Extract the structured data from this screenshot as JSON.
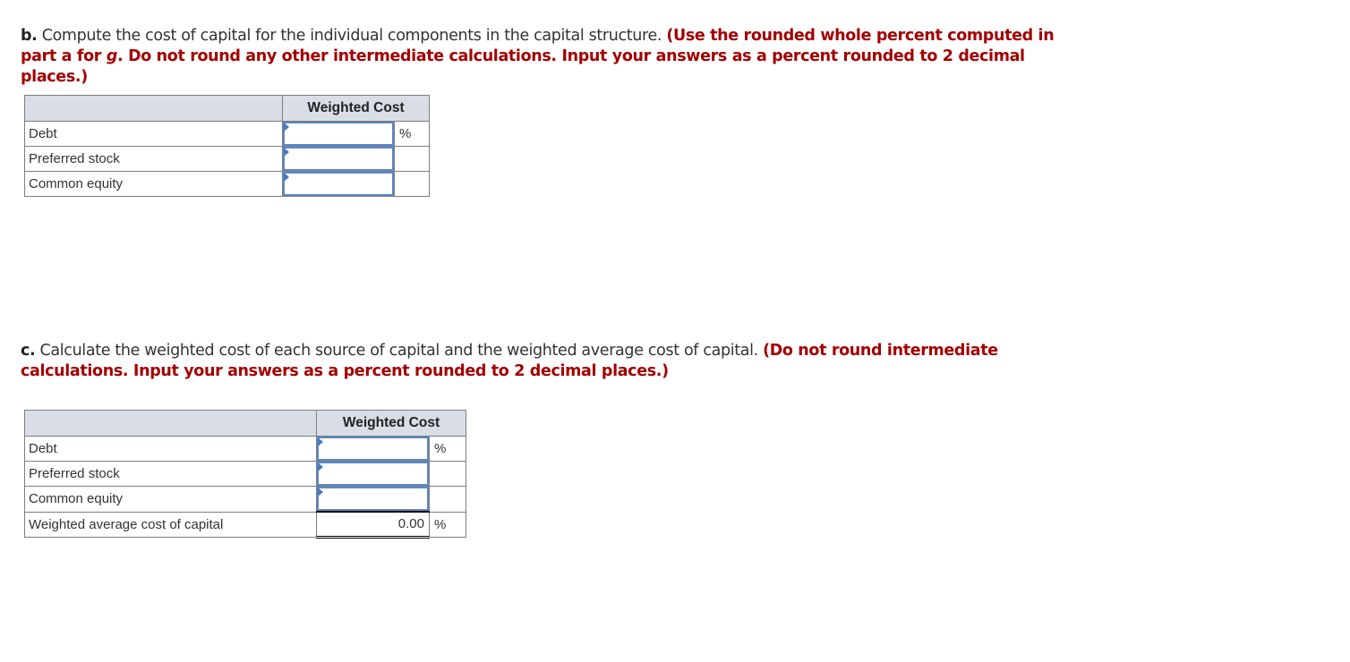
{
  "part_b": {
    "label": "b.",
    "text": " Compute the cost of capital for the individual components in the capital structure. ",
    "instruction_1": "(Use the rounded whole percent computed in part a for ",
    "instruction_var": "g",
    "instruction_2": ". Do not round any other intermediate calculations. Input your answers as a percent rounded to 2 decimal places.)",
    "table": {
      "header_blank": "",
      "header": "Weighted Cost",
      "rows": [
        {
          "label": "Debt",
          "value": "",
          "unit": "%"
        },
        {
          "label": "Preferred stock",
          "value": "",
          "unit": ""
        },
        {
          "label": "Common equity",
          "value": "",
          "unit": ""
        }
      ]
    }
  },
  "part_c": {
    "label": "c.",
    "text": " Calculate the weighted cost of each source of capital and the weighted average cost of capital. ",
    "instruction": "(Do not round intermediate calculations. Input your answers as a percent rounded to 2 decimal places.)",
    "table": {
      "header_blank": "",
      "header": "Weighted Cost",
      "rows": [
        {
          "label": "Debt",
          "value": "",
          "unit": "%"
        },
        {
          "label": "Preferred stock",
          "value": "",
          "unit": ""
        },
        {
          "label": "Common equity",
          "value": "",
          "unit": ""
        }
      ],
      "total": {
        "label": "Weighted average cost of capital",
        "value": "0.00",
        "unit": "%"
      }
    }
  },
  "colors": {
    "instruction_red": "#a30000",
    "header_bg": "#d9dee6",
    "input_border": "#5b88c9"
  }
}
